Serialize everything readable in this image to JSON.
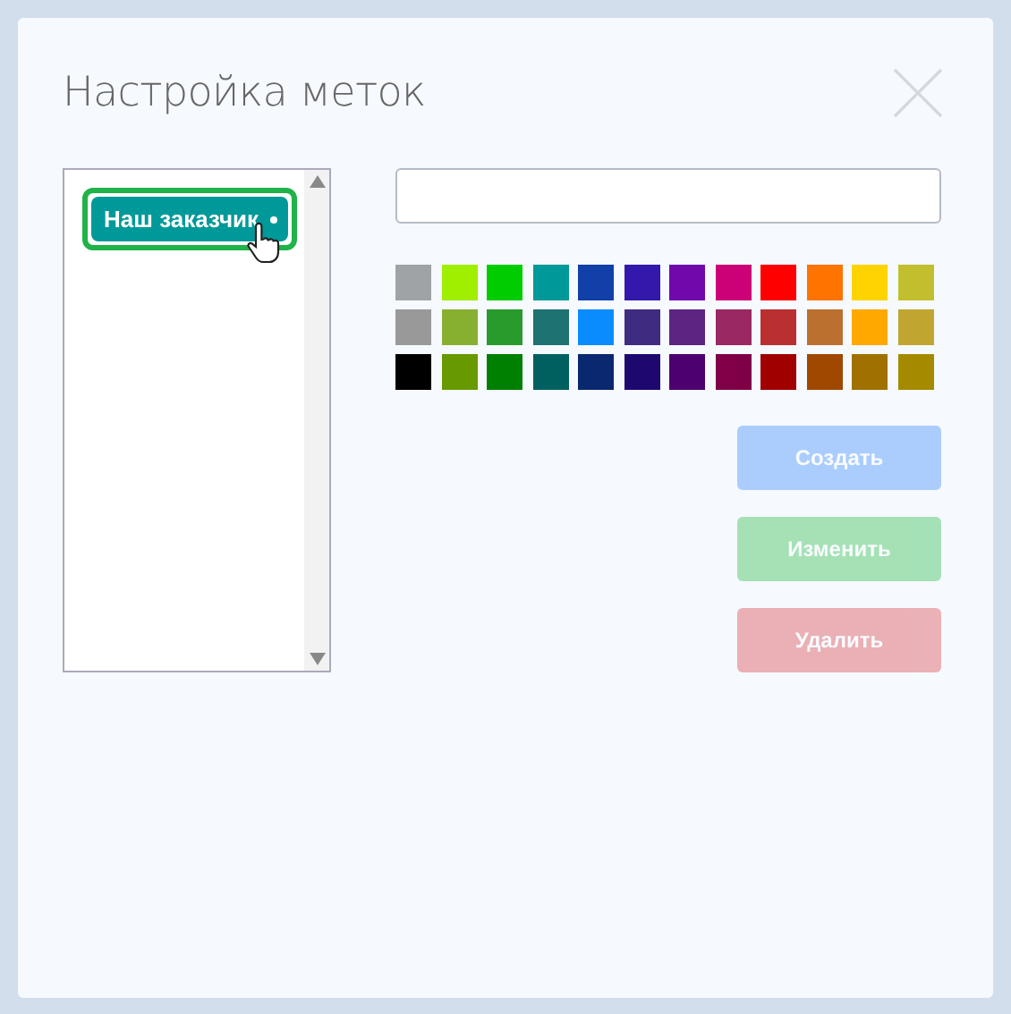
{
  "dialog": {
    "title": "Настройка меток"
  },
  "tags": [
    {
      "label": "Наш заказчик",
      "color": "#009999",
      "selected": true
    }
  ],
  "palette": [
    {
      "color": "#a0a3a6"
    },
    {
      "color": "#a0ee00"
    },
    {
      "color": "#00cc00"
    },
    {
      "color": "#009999"
    },
    {
      "color": "#1040a8"
    },
    {
      "color": "#3418ac"
    },
    {
      "color": "#7108ac"
    },
    {
      "color": "#cc0077"
    },
    {
      "color": "#ff0000"
    },
    {
      "color": "#ff7300"
    },
    {
      "color": "#ffd300"
    },
    {
      "color": "#c1bf2e"
    },
    {
      "color": "#999999"
    },
    {
      "color": "#88b030"
    },
    {
      "color": "#299a2c"
    },
    {
      "color": "#1e7272"
    },
    {
      "color": "#0a8cff"
    },
    {
      "color": "#3f2c80"
    },
    {
      "color": "#5e2482"
    },
    {
      "color": "#9a2862"
    },
    {
      "color": "#ba3030"
    },
    {
      "color": "#bb7030"
    },
    {
      "color": "#ffa800"
    },
    {
      "color": "#c0a530"
    },
    {
      "color": "#000000"
    },
    {
      "color": "#679a00"
    },
    {
      "color": "#008000"
    },
    {
      "color": "#006060"
    },
    {
      "color": "#0a2870"
    },
    {
      "color": "#1e0870"
    },
    {
      "color": "#4d006f"
    },
    {
      "color": "#800048"
    },
    {
      "color": "#a00000"
    },
    {
      "color": "#a04800"
    },
    {
      "color": "#a07000"
    },
    {
      "color": "#a58a00"
    }
  ],
  "buttons": [
    {
      "label": "Создать",
      "kind": "create",
      "disabled": true
    },
    {
      "label": "Изменить",
      "kind": "edit",
      "disabled": true
    },
    {
      "label": "Удалить",
      "kind": "delete",
      "disabled": true
    }
  ]
}
